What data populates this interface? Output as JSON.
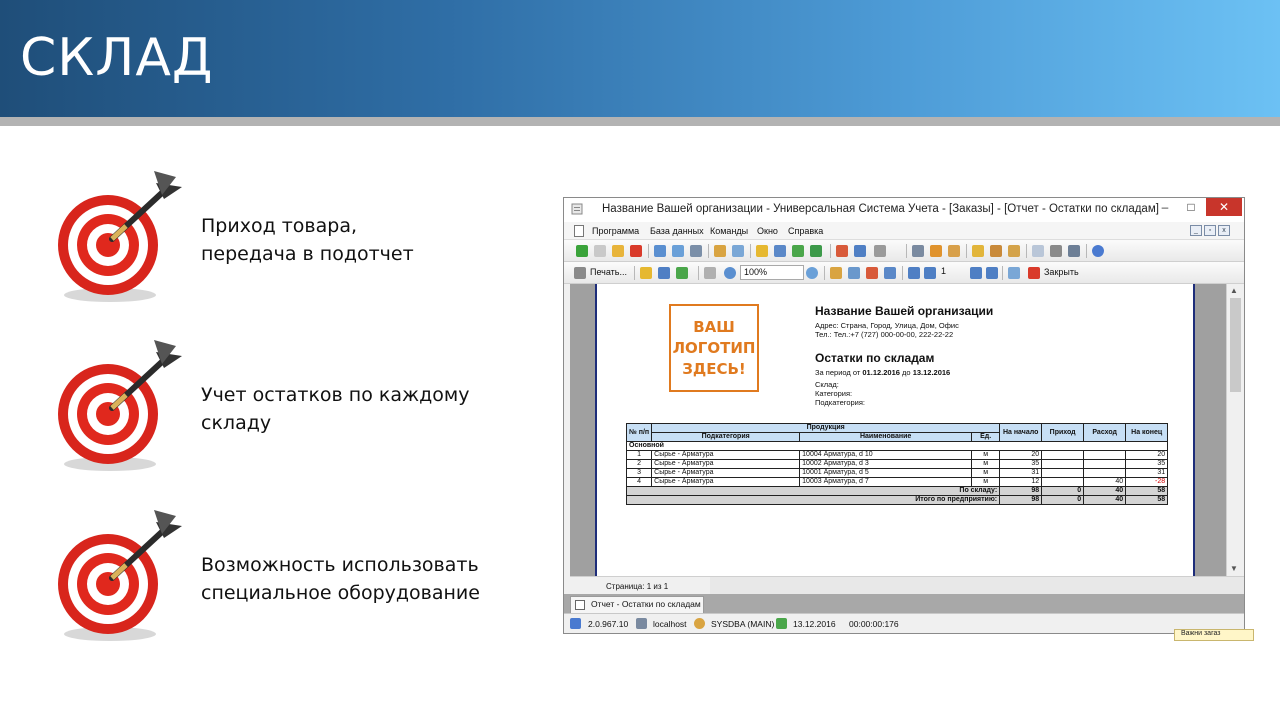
{
  "slide": {
    "title": "СКЛАД",
    "bullets": [
      {
        "lines": [
          "Приход товара,",
          "передача в подотчет"
        ],
        "icon": "dartboard-target-icon"
      },
      {
        "lines": [
          "Учет остатков по каждому",
          "складу"
        ],
        "icon": "dartboard-target-icon"
      },
      {
        "lines": [
          "Возможность использовать",
          "специальное оборудование"
        ],
        "icon": "dartboard-target-icon"
      }
    ]
  },
  "window": {
    "title": "Название Вашей организации - Универсальная Система Учета - [Заказы] - [Отчет - Остатки по складам]",
    "controls": {
      "minimize": "–",
      "maximize": "□",
      "close": "✕"
    },
    "menu": [
      "Программа",
      "База данных",
      "Команды",
      "Окно",
      "Справка"
    ],
    "mdi_controls": [
      "_",
      "▫",
      "x"
    ],
    "toolbar2": {
      "print_label": "Печать...",
      "zoom_value": "100%",
      "page_value": "1",
      "close_label": "Закрыть"
    }
  },
  "report": {
    "logo_lines": [
      "ВАШ",
      "ЛОГОТИП",
      "ЗДЕСЬ!"
    ],
    "org_name": "Название Вашей организации",
    "address": "Адрес: Страна, Город, Улица, Дом, Офис",
    "phone": "Тел.: Тел.:+7 (727) 000-00-00, 222-22-22",
    "title": "Остатки по складам",
    "period_prefix": "За период от",
    "period_from": "01.12.2016",
    "period_mid": "до",
    "period_to": "13.12.2016",
    "warehouse_label": "Склад:",
    "category_label": "Категория:",
    "subcategory_label": "Подкатегория:",
    "table": {
      "headers": {
        "num": "№ п/п",
        "product": "Продукция",
        "subcategory": "Подкатегория",
        "name": "Наименование",
        "unit": "Ед.",
        "start": "На начало",
        "income": "Приход",
        "expense": "Расход",
        "end": "На конец"
      },
      "group": "Основной",
      "rows": [
        {
          "n": "1",
          "sub": "Сырье - Арматура",
          "name": "10004 Арматура, d 10",
          "unit": "м",
          "start": "20",
          "income": "",
          "expense": "",
          "end": "20"
        },
        {
          "n": "2",
          "sub": "Сырье - Арматура",
          "name": "10002 Арматура, d 3",
          "unit": "м",
          "start": "35",
          "income": "",
          "expense": "",
          "end": "35"
        },
        {
          "n": "3",
          "sub": "Сырье - Арматура",
          "name": "10001 Арматура, d 5",
          "unit": "м",
          "start": "31",
          "income": "",
          "expense": "",
          "end": "31"
        },
        {
          "n": "4",
          "sub": "Сырье - Арматура",
          "name": "10003 Арматура, d 7",
          "unit": "м",
          "start": "12",
          "income": "",
          "expense": "40",
          "end": "-28"
        }
      ],
      "total_warehouse": {
        "label": "По складу:",
        "start": "98",
        "income": "0",
        "expense": "40",
        "end": "58"
      },
      "total_company": {
        "label": "Итого по предприятию:",
        "start": "98",
        "income": "0",
        "expense": "40",
        "end": "58"
      }
    }
  },
  "viewer": {
    "page_label": "Страница: 1 из 1"
  },
  "tab": {
    "label": "Отчет - Остатки по складам"
  },
  "status": {
    "version": "2.0.967.10",
    "host": "localhost",
    "user": "SYSDBA (MAIN)",
    "date": "13.12.2016",
    "time": "00:00:00:176",
    "tooltip": "Важни загаз"
  },
  "colors": {
    "banner_start": "#1f4e79",
    "banner_end": "#6cc1f4",
    "logo": "#e07a1f",
    "table_header": "#c7dff5",
    "negative": "#d00000",
    "close_button": "#c8352b"
  }
}
